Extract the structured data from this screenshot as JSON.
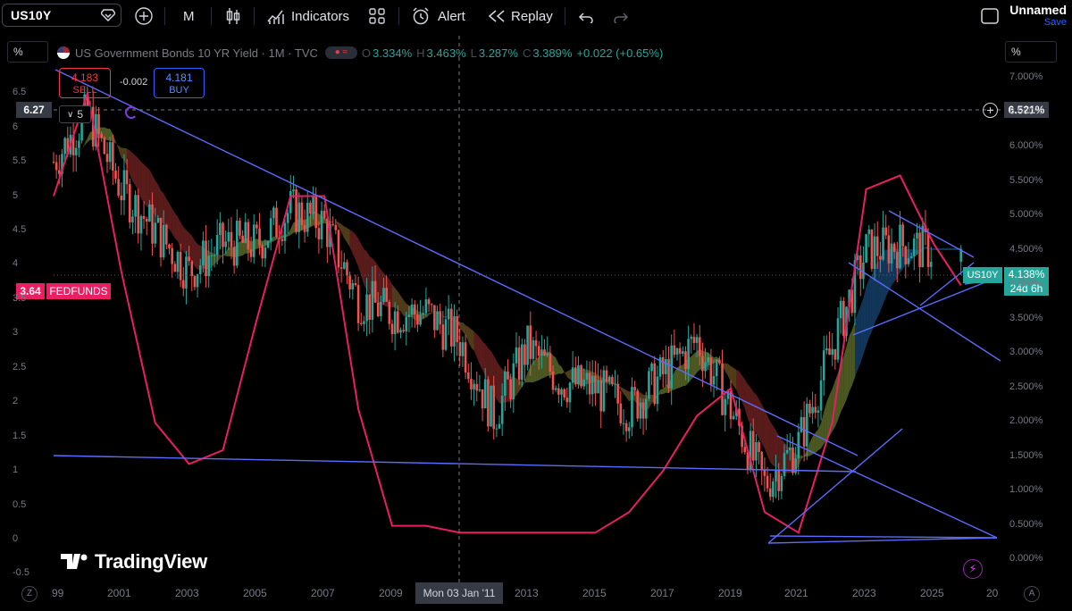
{
  "toolbar": {
    "symbol": "US10Y",
    "interval": "M",
    "indicators_label": "Indicators",
    "alert_label": "Alert",
    "replay_label": "Replay",
    "layout_name": "Unnamed",
    "save_label": "Save"
  },
  "legend": {
    "title": "US Government Bonds 10 YR Yield · 1M · TVC",
    "open_key": "O",
    "open": "3.334%",
    "high_key": "H",
    "high": "3.463%",
    "low_key": "L",
    "low": "3.287%",
    "close_key": "C",
    "close": "3.389%",
    "change": "+0.022 (+0.65%)"
  },
  "trade": {
    "sell_price": "4.183",
    "sell_label": "SELL",
    "spread": "-0.002",
    "buy_price": "4.181",
    "buy_label": "BUY",
    "quantity": "5"
  },
  "unit_left": "%",
  "unit_right": "%",
  "left_axis_ticks": [
    "6.5",
    "6",
    "5.5",
    "5",
    "4.5",
    "4",
    "3.5",
    "3",
    "2.5",
    "2",
    "1.5",
    "1",
    "0.5",
    "0",
    "-0.5"
  ],
  "right_axis_ticks": [
    "7.000%",
    "6.500%",
    "6.000%",
    "5.500%",
    "5.000%",
    "4.500%",
    "4.000%",
    "3.500%",
    "3.000%",
    "2.500%",
    "2.000%",
    "1.500%",
    "1.000%",
    "0.500%",
    "0.000%"
  ],
  "x_axis_ticks": [
    "99",
    "2001",
    "2003",
    "2005",
    "2007",
    "2009",
    "2013",
    "2015",
    "2017",
    "2019",
    "2021",
    "2023",
    "2025",
    "20"
  ],
  "crosshair_date": "Mon 03 Jan '11",
  "labels": {
    "left_cross_value": "6.27",
    "right_cross_value": "6.521%",
    "fedfunds_value": "3.64",
    "fedfunds_name": "FEDFUNDS",
    "us10y_tag": "US10Y",
    "us10y_value": "4.138%",
    "countdown": "24d 6h"
  },
  "branding": "TradingView",
  "bottom": {
    "left_key": "Z",
    "right_key": "A"
  },
  "colors": {
    "up": "#26a69a",
    "down": "#ef5350",
    "fedfunds": "#e91e63",
    "trendline": "#5b6cff",
    "accent": "#2962ff"
  },
  "chart_data": {
    "type": "candlestick",
    "title": "US Government Bonds 10 YR Yield · 1M · TVC",
    "ylabel": "%",
    "ylim": [
      -0.5,
      7.0
    ],
    "series": [
      {
        "name": "US10Y",
        "x": [
          1999,
          2000,
          2001,
          2002,
          2003,
          2004,
          2005,
          2006,
          2007,
          2008,
          2009,
          2010,
          2011,
          2012,
          2013,
          2014,
          2015,
          2016,
          2017,
          2018,
          2019,
          2020,
          2021,
          2022,
          2023,
          2024,
          2025
        ],
        "values": [
          5.5,
          6.2,
          5.1,
          4.5,
          3.9,
          4.3,
          4.3,
          4.8,
          4.6,
          3.5,
          3.3,
          3.3,
          2.9,
          1.8,
          2.8,
          2.3,
          2.2,
          1.9,
          2.4,
          2.9,
          1.9,
          0.8,
          1.4,
          2.8,
          4.2,
          4.3,
          4.2
        ]
      },
      {
        "name": "FEDFUNDS",
        "x": [
          1999,
          2000,
          2001,
          2002,
          2003,
          2004,
          2005,
          2006,
          2007,
          2008,
          2009,
          2010,
          2011,
          2012,
          2013,
          2014,
          2015,
          2016,
          2017,
          2018,
          2019,
          2020,
          2021,
          2022,
          2023,
          2024,
          2025
        ],
        "values": [
          5.0,
          6.5,
          3.9,
          1.7,
          1.1,
          1.3,
          3.2,
          5.0,
          5.0,
          1.9,
          0.2,
          0.2,
          0.1,
          0.1,
          0.1,
          0.1,
          0.1,
          0.4,
          1.0,
          1.8,
          2.2,
          0.4,
          0.1,
          1.7,
          5.1,
          5.3,
          4.3
        ]
      }
    ],
    "last_value": 4.138,
    "fedfunds_last": 3.64
  }
}
